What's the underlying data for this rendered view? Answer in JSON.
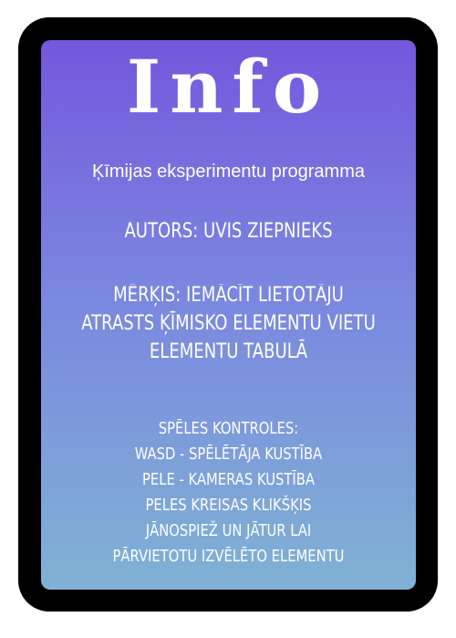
{
  "info_card": {
    "title": "Info",
    "subtitle": "Ķīmijas eksperimentu programma",
    "author": "AUTORS: UVIS ZIEPNIEKS",
    "goal_lines": [
      "MĒRĶIS: IEMĀCĪT LIETOTĀJU",
      "ATRASTS ĶĪMISKO ELEMENTU VIETU",
      "ELEMENTU TABULĀ"
    ],
    "controls_lines": [
      "SPĒLES KONTROLES:",
      "WASD - SPĒLĒTĀJA KUSTĪBA",
      "PELE - KAMERAS KUSTĪBA",
      "PELES KREISAS KLIKŠĶIS",
      "JĀNOSPIEŽ UN JĀTUR LAI",
      "PĀRVIETOTU IZVĒLĒTO ELEMENTU"
    ]
  },
  "colors": {
    "frame": "#000000",
    "gradient_top": "#7457dd",
    "gradient_bottom": "#80b2d4",
    "text": "#ffffff"
  }
}
